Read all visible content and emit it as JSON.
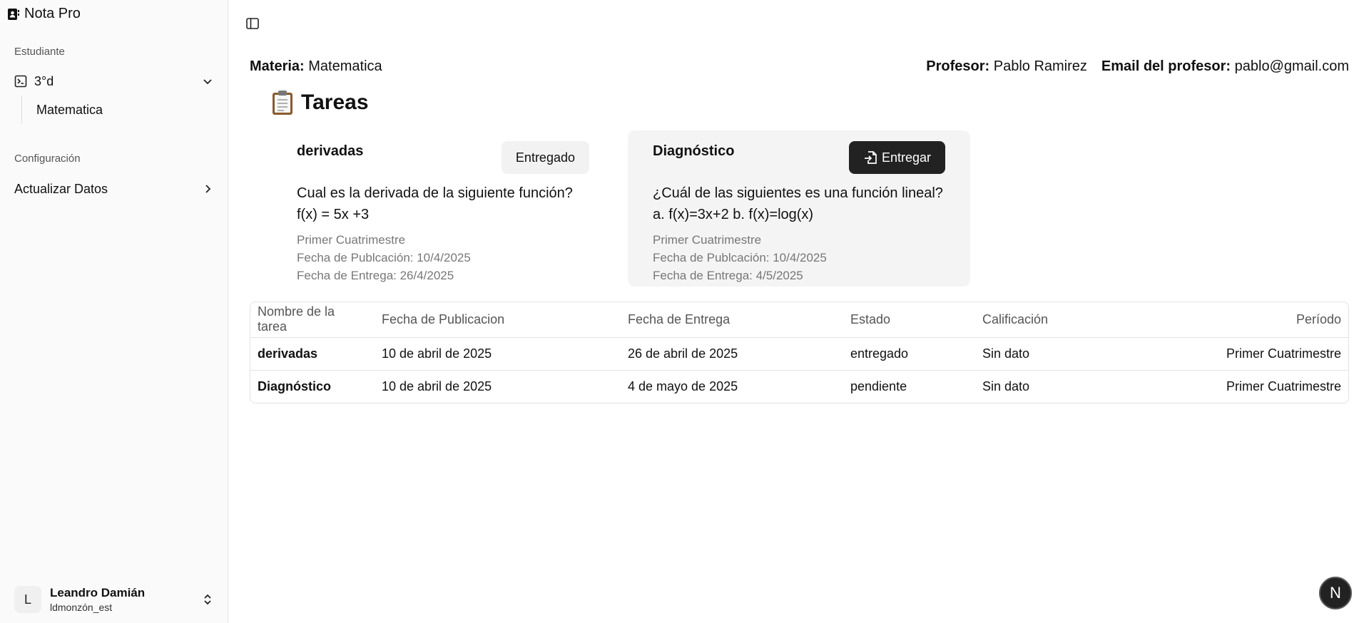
{
  "app": {
    "title": "Nota Pro"
  },
  "sidebar": {
    "section_estudiante": "Estudiante",
    "course": "3°d",
    "subject": "Matematica",
    "section_config": "Configuración",
    "update_label": "Actualizar Datos"
  },
  "user": {
    "initial": "L",
    "name": "Leandro Damián",
    "handle": "ldmonzón_est"
  },
  "header": {
    "materia_label": "Materia:",
    "materia_value": "Matematica",
    "profesor_label": "Profesor:",
    "profesor_value": "Pablo Ramirez",
    "email_label": "Email del profesor:",
    "email_value": "pablo@gmail.com"
  },
  "tasks_title": "Tareas",
  "cards": [
    {
      "title": "derivadas",
      "button": "Entregado",
      "question_line1": "Cual es la derivada de la siguiente función?",
      "question_line2": "f(x) = 5x +3",
      "period": "Primer Cuatrimestre",
      "published": "Fecha de Publcación: 10/4/2025",
      "due": "Fecha de Entrega: 26/4/2025"
    },
    {
      "title": "Diagnóstico",
      "button": "Entregar",
      "question_line1": "¿Cuál de las siguientes es una función lineal?",
      "question_line2": "a. f(x)=3x+2 b. f(x)=log(x)",
      "period": "Primer Cuatrimestre",
      "published": "Fecha de Publcación: 10/4/2025",
      "due": "Fecha de Entrega: 4/5/2025"
    }
  ],
  "table": {
    "headers": [
      "Nombre de la tarea",
      "Fecha de Publicacion",
      "Fecha de Entrega",
      "Estado",
      "Calificación",
      "Período"
    ],
    "rows": [
      [
        "derivadas",
        "10 de abril de 2025",
        "26 de abril de 2025",
        "entregado",
        "Sin dato",
        "Primer Cuatrimestre"
      ],
      [
        "Diagnóstico",
        "10 de abril de 2025",
        "4 de mayo de 2025",
        "pendiente",
        "Sin dato",
        "Primer Cuatrimestre"
      ]
    ]
  },
  "badge": "N",
  "icons": {
    "brand": "contact-book-icon",
    "course": "terminal-square-icon",
    "sidebar_toggle": "panel-left-icon",
    "clipboard": "clipboard-icon",
    "submit": "file-input-icon"
  }
}
